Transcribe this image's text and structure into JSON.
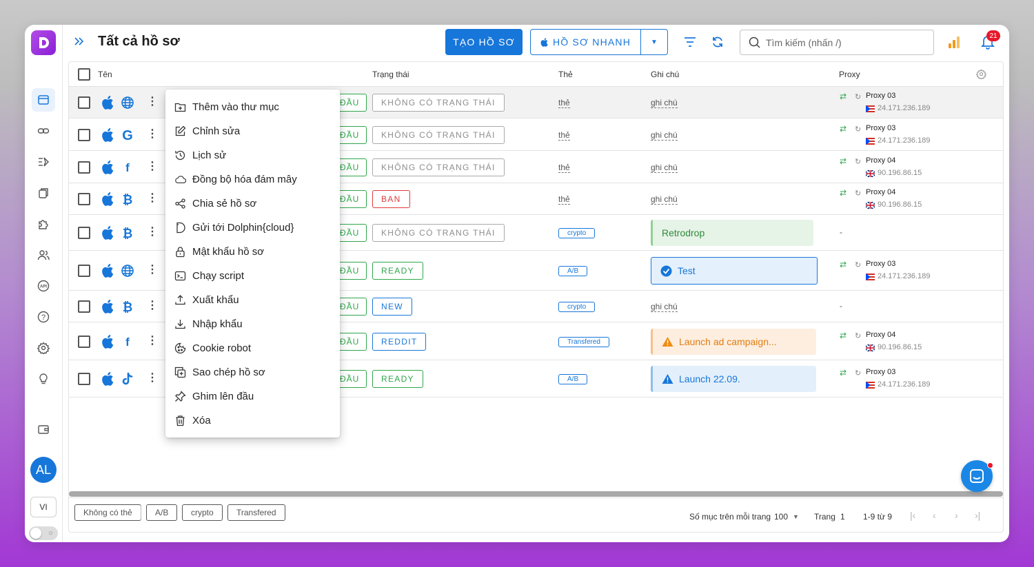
{
  "header": {
    "title": "Tất cả hồ sơ",
    "create_label": "TẠO HỒ SƠ",
    "quick_label": "HỒ SƠ NHANH",
    "search_placeholder": "Tìm kiếm (nhấn /)",
    "notification_count": "21"
  },
  "sidebar": {
    "avatar": "AL",
    "language": "VI",
    "icons": [
      "profiles-icon",
      "link-icon",
      "automation-icon",
      "extensions-icon",
      "puzzle-icon",
      "users-icon",
      "api-icon",
      "help-icon",
      "settings-icon",
      "lightbulb-icon",
      "wallet-icon"
    ]
  },
  "table": {
    "columns": {
      "name": "Tên",
      "status": "Trạng thái",
      "tags": "Thẻ",
      "notes": "Ghi chú",
      "proxy": "Proxy"
    },
    "start_label": "ĐẦU",
    "rows": [
      {
        "os": "apple",
        "site": "globe",
        "status": "KHÔNG CÓ TRẠNG THÁI",
        "status_color": "gray",
        "tag": "thẻ",
        "note": "ghi chú",
        "proxy_name": "Proxy 03",
        "proxy_ip": "24.171.236.189",
        "flag": "pr"
      },
      {
        "os": "apple",
        "site": "google",
        "status": "KHÔNG CÓ TRẠNG THÁI",
        "status_color": "gray",
        "tag": "thẻ",
        "note": "ghi chú",
        "proxy_name": "Proxy 03",
        "proxy_ip": "24.171.236.189",
        "flag": "pr"
      },
      {
        "os": "apple",
        "site": "facebook",
        "status": "KHÔNG CÓ TRẠNG THÁI",
        "status_color": "gray",
        "tag": "thẻ",
        "note": "ghi chú",
        "proxy_name": "Proxy 04",
        "proxy_ip": "90.196.86.15",
        "flag": "uk"
      },
      {
        "os": "apple",
        "site": "bitcoin",
        "status": "BAN",
        "status_color": "red",
        "tag": "thẻ",
        "note": "ghi chú",
        "proxy_name": "Proxy 04",
        "proxy_ip": "90.196.86.15",
        "flag": "uk"
      },
      {
        "os": "apple",
        "site": "bitcoin",
        "status": "KHÔNG CÓ TRẠNG THÁI",
        "status_color": "gray",
        "tag_chip": "crypto",
        "note_box": "Retrodrop",
        "note_style": "green",
        "proxy_dash": "-"
      },
      {
        "os": "apple",
        "site": "globe",
        "status": "READY",
        "status_color": "green",
        "tag_chip": "A/B",
        "note_box": "Test",
        "note_style": "blue-sel",
        "proxy_name": "Proxy 03",
        "proxy_ip": "24.171.236.189",
        "flag": "pr"
      },
      {
        "os": "apple",
        "site": "bitcoin",
        "status": "NEW",
        "status_color": "blue",
        "tag_chip": "crypto",
        "note": "ghi chú",
        "proxy_dash": "-"
      },
      {
        "os": "apple",
        "site": "facebook",
        "status": "REDDIT",
        "status_color": "blue",
        "tag_chip": "Transfered",
        "note_box": "Launch ad campaign...",
        "note_style": "orange",
        "proxy_name": "Proxy 04",
        "proxy_ip": "90.196.86.15",
        "flag": "uk"
      },
      {
        "os": "apple",
        "site": "tiktok",
        "status": "READY",
        "status_color": "green",
        "tag_chip": "A/B",
        "note_box": "Launch 22.09.",
        "note_style": "blue",
        "proxy_name": "Proxy 03",
        "proxy_ip": "24.171.236.189",
        "flag": "pr"
      }
    ]
  },
  "context_menu": {
    "items": [
      {
        "label": "Thêm vào thư mục",
        "icon": "folder-plus-icon"
      },
      {
        "label": "Chỉnh sửa",
        "icon": "edit-icon"
      },
      {
        "label": "Lịch sử",
        "icon": "history-icon"
      },
      {
        "label": "Đồng bộ hóa đám mây",
        "icon": "cloud-icon"
      },
      {
        "label": "Chia sẻ hồ sơ",
        "icon": "share-icon"
      },
      {
        "label": "Gửi tới Dolphin{cloud}",
        "icon": "dolphin-icon"
      },
      {
        "label": "Mật khẩu hồ sơ",
        "icon": "lock-icon"
      },
      {
        "label": "Chạy script",
        "icon": "terminal-icon"
      },
      {
        "label": "Xuất khẩu",
        "icon": "upload-icon"
      },
      {
        "label": "Nhập khẩu",
        "icon": "download-icon"
      },
      {
        "label": "Cookie robot",
        "icon": "cookie-icon"
      },
      {
        "label": "Sao chép hồ sơ",
        "icon": "copy-icon"
      },
      {
        "label": "Ghim lên đầu",
        "icon": "pin-icon"
      },
      {
        "label": "Xóa",
        "icon": "trash-icon"
      }
    ]
  },
  "footer": {
    "tag_filters": [
      "Không có thẻ",
      "A/B",
      "crypto",
      "Transfered"
    ],
    "per_page_label": "Số mục trên mỗi trang",
    "per_page_value": "100",
    "page_label": "Trang",
    "page_value": "1",
    "range": "1-9 từ 9"
  },
  "colors": {
    "primary": "#1776d9",
    "green": "#2ea64a",
    "red": "#e23b3b",
    "orange": "#e07d12"
  }
}
